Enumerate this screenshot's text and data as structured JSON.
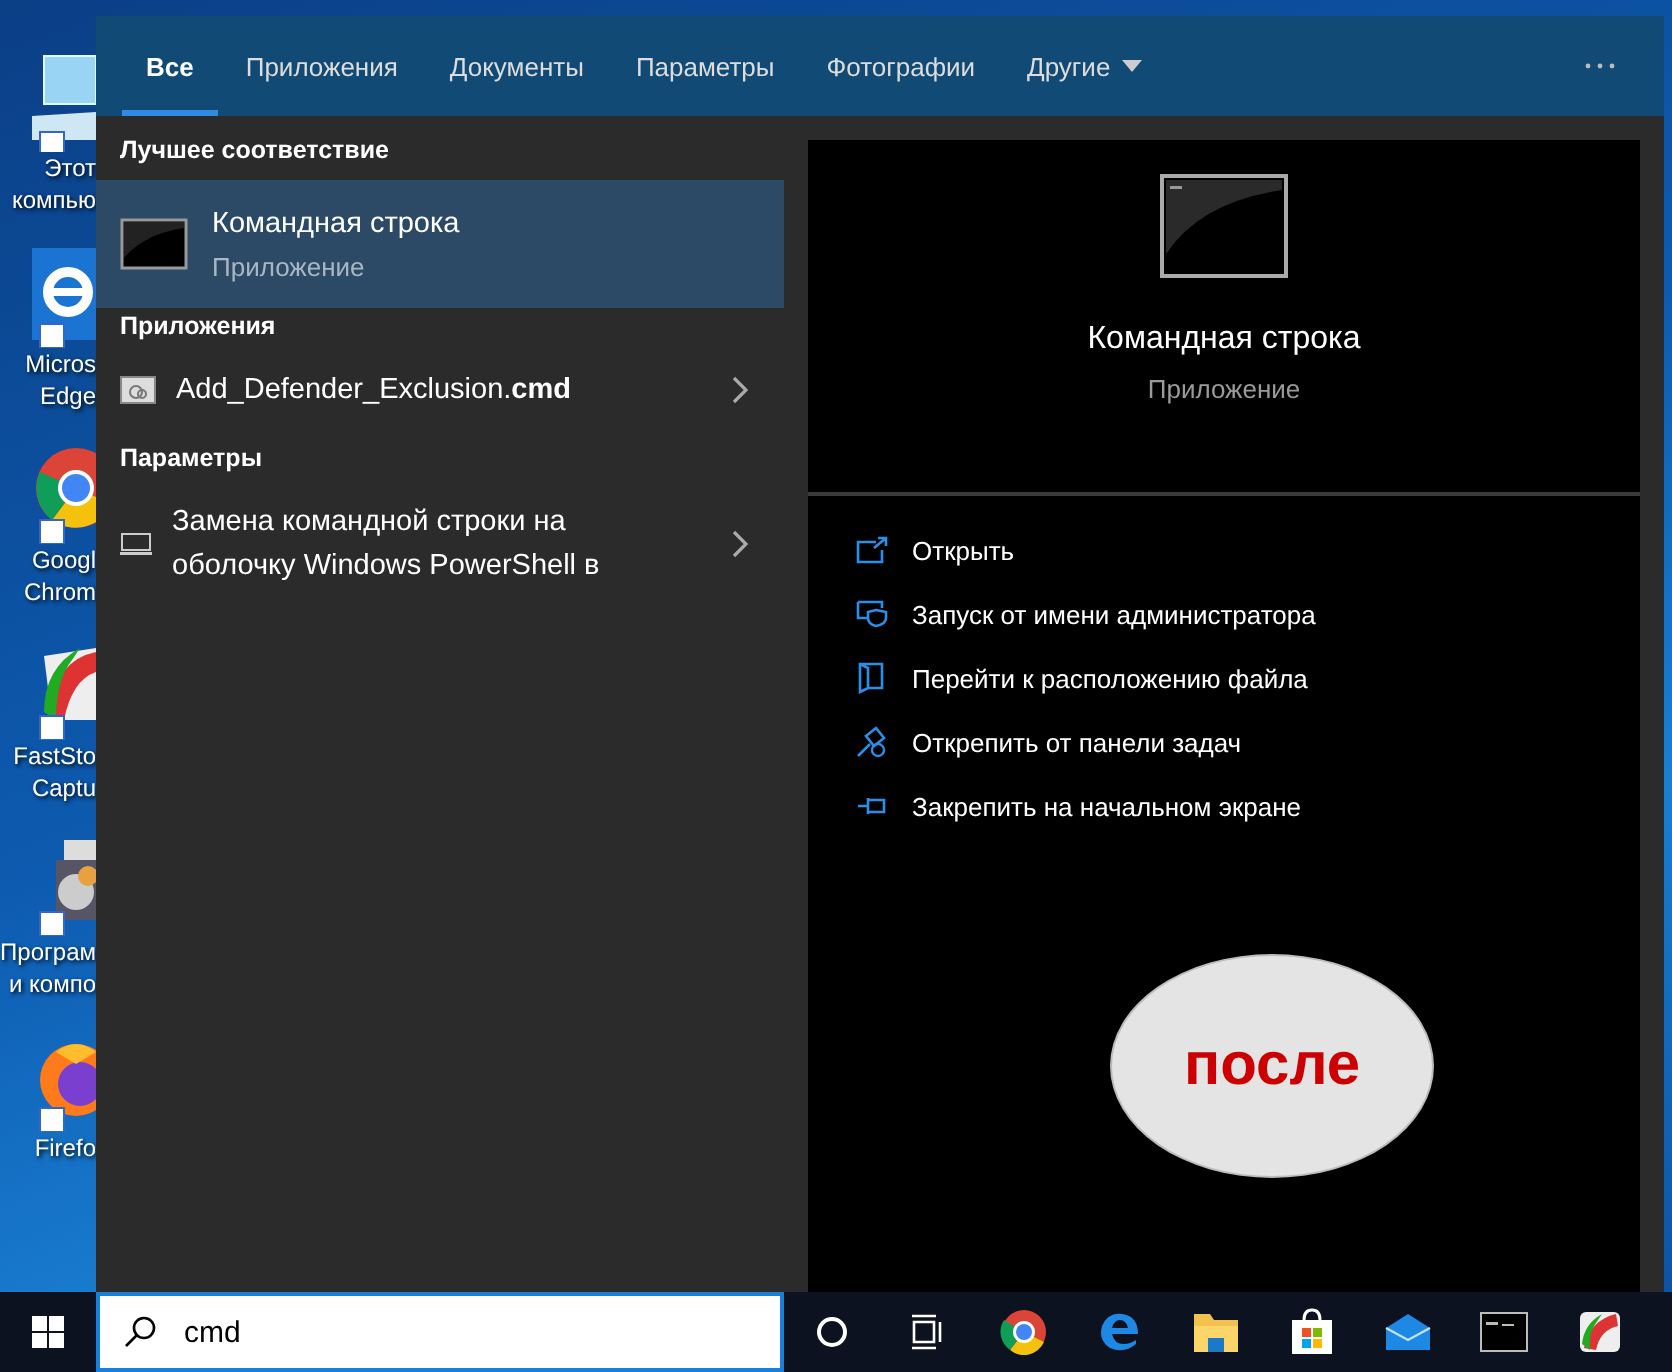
{
  "desktop_icons": [
    {
      "kind": "computer",
      "lines": [
        "Этот",
        "компью"
      ]
    },
    {
      "kind": "edge",
      "lines": [
        "Micros",
        "Edge"
      ]
    },
    {
      "kind": "chrome",
      "lines": [
        "Googl",
        "Chrom"
      ]
    },
    {
      "kind": "capture",
      "lines": [
        "FastSto",
        "Captu"
      ]
    },
    {
      "kind": "programs",
      "lines": [
        "Програм",
        "и компо"
      ]
    },
    {
      "kind": "firefox",
      "lines": [
        "Firefo"
      ]
    }
  ],
  "search_panel": {
    "tabs": [
      {
        "label": "Все",
        "selected": true,
        "kind": "tab"
      },
      {
        "label": "Приложения",
        "selected": false,
        "kind": "tab"
      },
      {
        "label": "Документы",
        "selected": false,
        "kind": "tab"
      },
      {
        "label": "Параметры",
        "selected": false,
        "kind": "tab"
      },
      {
        "label": "Фотографии",
        "selected": false,
        "kind": "tab"
      },
      {
        "label": "Другие",
        "selected": false,
        "kind": "dropdown"
      }
    ],
    "sections": [
      {
        "heading": "Лучшее соответствие",
        "items": [
          {
            "kind": "best",
            "title": "Командная строка",
            "subtitle": "Приложение",
            "selected": true
          }
        ]
      },
      {
        "heading": "Приложения",
        "items": [
          {
            "kind": "file",
            "title": "Add_Defender_Exclusion.",
            "title_bold": "cmd",
            "selected": false
          }
        ]
      },
      {
        "heading": "Параметры",
        "items": [
          {
            "kind": "setting",
            "title": "Замена командной строки на оболочку Windows PowerShell в",
            "selected": false
          }
        ]
      }
    ],
    "preview": {
      "title": "Командная строка",
      "subtitle": "Приложение",
      "actions": [
        {
          "kind": "open",
          "label": "Открыть"
        },
        {
          "kind": "admin",
          "label": "Запуск от имени администратора"
        },
        {
          "kind": "folder",
          "label": "Перейти к расположению файла"
        },
        {
          "kind": "unpin",
          "label": "Открепить от панели задач"
        },
        {
          "kind": "pin",
          "label": "Закрепить на начальном экране"
        }
      ],
      "annotation": "после"
    }
  },
  "search": {
    "value": "cmd"
  },
  "taskbar": [
    {
      "kind": "cortana"
    },
    {
      "kind": "taskview"
    },
    {
      "kind": "chrome"
    },
    {
      "kind": "edge"
    },
    {
      "kind": "explorer"
    },
    {
      "kind": "store"
    },
    {
      "kind": "mail"
    },
    {
      "kind": "console"
    },
    {
      "kind": "capture"
    }
  ]
}
